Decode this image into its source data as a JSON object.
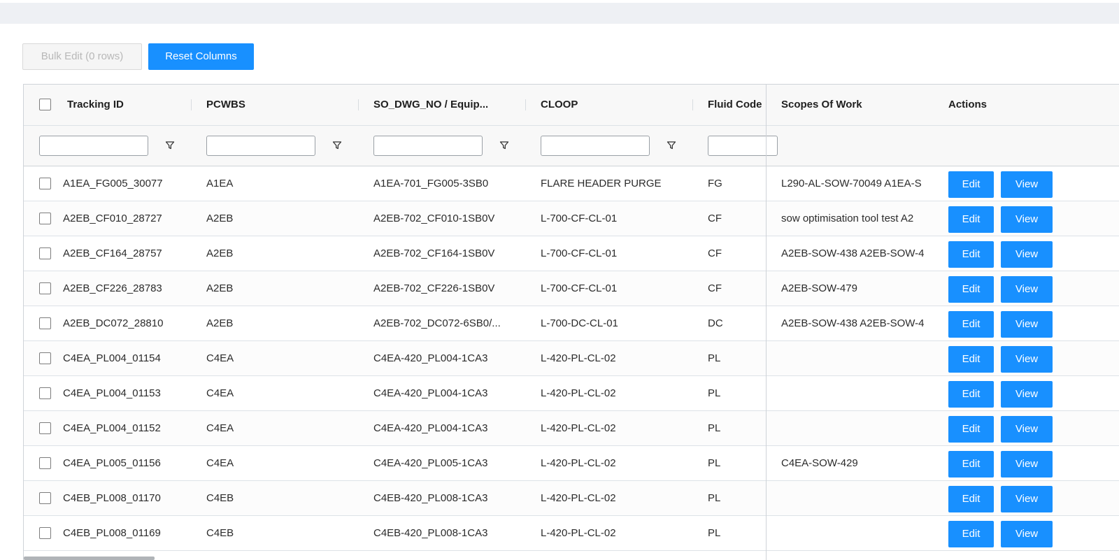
{
  "toolbar": {
    "bulk_edit_label": "Bulk Edit (0 rows)",
    "reset_columns_label": "Reset Columns"
  },
  "columns": {
    "tracking_id": "Tracking ID",
    "pcwbs": "PCWBS",
    "so_dwg_no": "SO_DWG_NO / Equip...",
    "cloop": "CLOOP",
    "fluid_code": "Fluid Code",
    "scopes_of_work": "Scopes Of Work",
    "actions": "Actions"
  },
  "row_actions": {
    "edit_label": "Edit",
    "view_label": "View"
  },
  "rows": [
    {
      "tracking_id": "A1EA_FG005_30077",
      "pcwbs": "A1EA",
      "so_dwg_no": "A1EA-701_FG005-3SB0",
      "cloop": "FLARE HEADER PURGE",
      "fluid_code": "FG",
      "scopes_of_work": "L290-AL-SOW-70049  A1EA-S"
    },
    {
      "tracking_id": "A2EB_CF010_28727",
      "pcwbs": "A2EB",
      "so_dwg_no": "A2EB-702_CF010-1SB0V",
      "cloop": "L-700-CF-CL-01",
      "fluid_code": "CF",
      "scopes_of_work": "sow optimisation tool test  A2"
    },
    {
      "tracking_id": "A2EB_CF164_28757",
      "pcwbs": "A2EB",
      "so_dwg_no": "A2EB-702_CF164-1SB0V",
      "cloop": "L-700-CF-CL-01",
      "fluid_code": "CF",
      "scopes_of_work": "A2EB-SOW-438  A2EB-SOW-4"
    },
    {
      "tracking_id": "A2EB_CF226_28783",
      "pcwbs": "A2EB",
      "so_dwg_no": "A2EB-702_CF226-1SB0V",
      "cloop": "L-700-CF-CL-01",
      "fluid_code": "CF",
      "scopes_of_work": "A2EB-SOW-479"
    },
    {
      "tracking_id": "A2EB_DC072_28810",
      "pcwbs": "A2EB",
      "so_dwg_no": "A2EB-702_DC072-6SB0/...",
      "cloop": "L-700-DC-CL-01",
      "fluid_code": "DC",
      "scopes_of_work": "A2EB-SOW-438  A2EB-SOW-4"
    },
    {
      "tracking_id": "C4EA_PL004_01154",
      "pcwbs": "C4EA",
      "so_dwg_no": "C4EA-420_PL004-1CA3",
      "cloop": "L-420-PL-CL-02",
      "fluid_code": "PL",
      "scopes_of_work": ""
    },
    {
      "tracking_id": "C4EA_PL004_01153",
      "pcwbs": "C4EA",
      "so_dwg_no": "C4EA-420_PL004-1CA3",
      "cloop": "L-420-PL-CL-02",
      "fluid_code": "PL",
      "scopes_of_work": ""
    },
    {
      "tracking_id": "C4EA_PL004_01152",
      "pcwbs": "C4EA",
      "so_dwg_no": "C4EA-420_PL004-1CA3",
      "cloop": "L-420-PL-CL-02",
      "fluid_code": "PL",
      "scopes_of_work": ""
    },
    {
      "tracking_id": "C4EA_PL005_01156",
      "pcwbs": "C4EA",
      "so_dwg_no": "C4EA-420_PL005-1CA3",
      "cloop": "L-420-PL-CL-02",
      "fluid_code": "PL",
      "scopes_of_work": "C4EA-SOW-429"
    },
    {
      "tracking_id": "C4EB_PL008_01170",
      "pcwbs": "C4EB",
      "so_dwg_no": "C4EB-420_PL008-1CA3",
      "cloop": "L-420-PL-CL-02",
      "fluid_code": "PL",
      "scopes_of_work": ""
    },
    {
      "tracking_id": "C4EB_PL008_01169",
      "pcwbs": "C4EB",
      "so_dwg_no": "C4EB-420_PL008-1CA3",
      "cloop": "L-420-PL-CL-02",
      "fluid_code": "PL",
      "scopes_of_work": ""
    }
  ]
}
